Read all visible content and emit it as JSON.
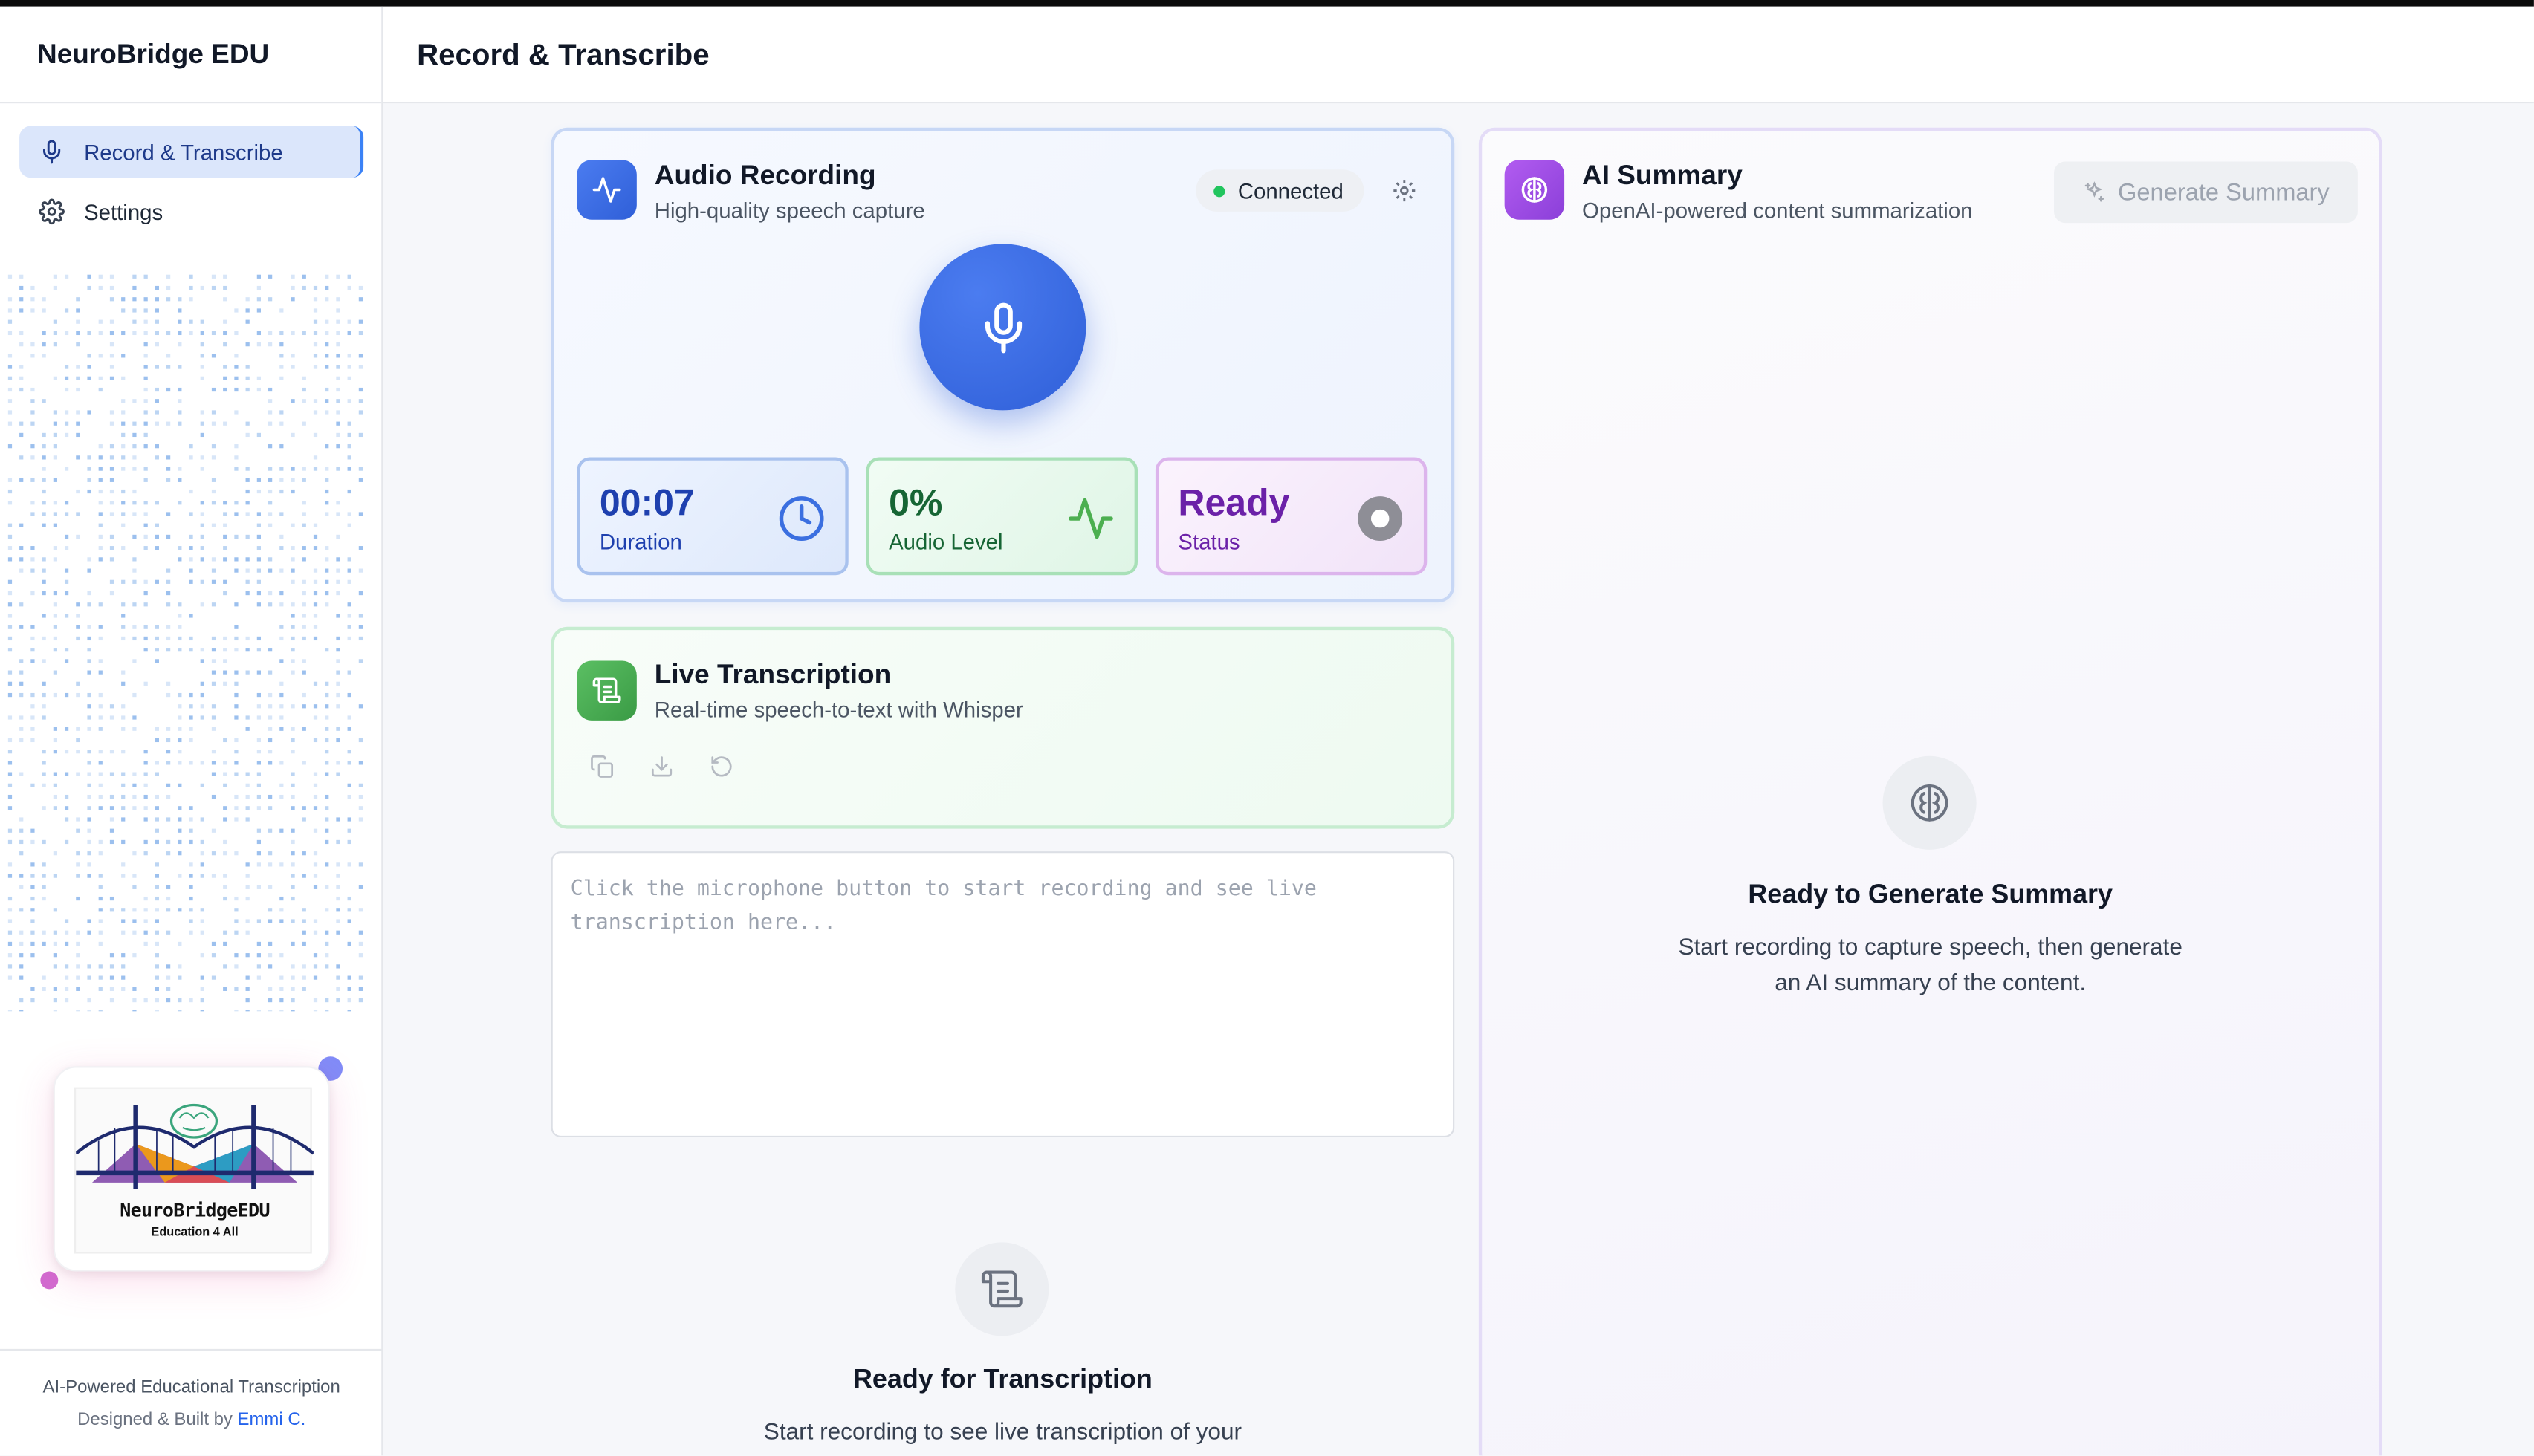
{
  "app": {
    "brand": "NeuroBridge EDU",
    "page_title": "Record & Transcribe"
  },
  "sidebar": {
    "items": [
      {
        "label": "Record & Transcribe",
        "icon": "microphone-icon",
        "active": true
      },
      {
        "label": "Settings",
        "icon": "gear-icon",
        "active": false
      }
    ],
    "logo": {
      "title": "NeuroBridgeEDU",
      "subtitle": "Education 4 All"
    },
    "footer": {
      "line1": "AI-Powered Educational Transcription",
      "line2_prefix": "Designed & Built by",
      "author": "Emmi C."
    }
  },
  "audio": {
    "title": "Audio Recording",
    "subtitle": "High-quality speech capture",
    "connection": "Connected",
    "stats": {
      "duration": {
        "value": "00:07",
        "label": "Duration"
      },
      "level": {
        "value": "0%",
        "label": "Audio Level"
      },
      "status": {
        "value": "Ready",
        "label": "Status"
      }
    }
  },
  "live": {
    "title": "Live Transcription",
    "subtitle": "Real-time speech-to-text with Whisper",
    "tools": [
      "copy-icon",
      "download-icon",
      "reset-icon"
    ],
    "placeholder": "Click the microphone button to start recording and see live transcription here...",
    "empty_title": "Ready for Transcription",
    "empty_desc": "Start recording to see live transcription of your"
  },
  "ai": {
    "title": "AI Summary",
    "subtitle": "OpenAI-powered content summarization",
    "button": "Generate Summary",
    "empty_title": "Ready to Generate Summary",
    "empty_desc_1": "Start recording to capture speech, then generate",
    "empty_desc_2": "an AI summary of the content."
  },
  "colors": {
    "accent_blue": "#3b6fe0",
    "green": "#4caf50",
    "purple": "#9b4fe0",
    "connected_dot": "#22c55e"
  }
}
